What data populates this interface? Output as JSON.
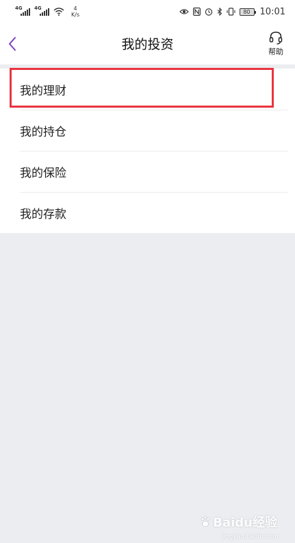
{
  "status_bar": {
    "sim1_tag": "4G",
    "sim2_tag": "4G",
    "net_speed_value": "4",
    "net_speed_unit": "K/s",
    "battery_level": "80",
    "time": "10:01"
  },
  "header": {
    "title": "我的投资",
    "help_label": "帮助",
    "accent_color": "#7b3fc4"
  },
  "menu": {
    "items": [
      {
        "label": "我的理财"
      },
      {
        "label": "我的持仓"
      },
      {
        "label": "我的保险"
      },
      {
        "label": "我的存款"
      }
    ]
  },
  "highlight_color": "#e8343f",
  "watermark": {
    "text": "Baidu经验",
    "subtext": "jingyan.baidu.com"
  }
}
